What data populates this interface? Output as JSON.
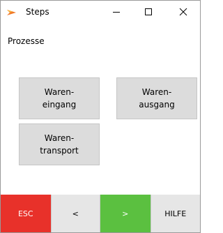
{
  "window": {
    "title": "Steps",
    "icon": "app-logo-icon",
    "controls": {
      "minimize": "—",
      "maximize": "☐",
      "close": "✕"
    }
  },
  "main": {
    "section_label": "Prozesse",
    "tiles": [
      {
        "label": "Waren-\neingang"
      },
      {
        "label": "Waren-\nausgang"
      },
      {
        "label": "Waren-\ntransport"
      }
    ]
  },
  "bottom_bar": {
    "esc": "ESC",
    "prev": "<",
    "next": ">",
    "help": "HILFE"
  },
  "colors": {
    "esc": "#e8312a",
    "next": "#5bc040",
    "tile": "#dcdcdc",
    "neutral": "#e6e6e6"
  }
}
